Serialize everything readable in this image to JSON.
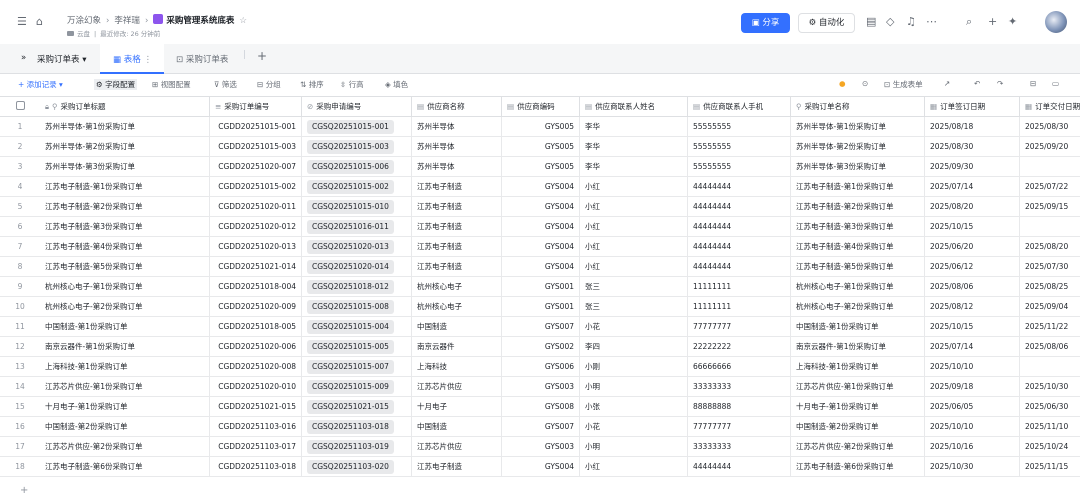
{
  "header": {
    "workspace": "万涂幻象",
    "owner": "李祥瑞",
    "title": "采购管理系统底表",
    "cloud_label": "云盘",
    "modified": "最近修改: 26 分钟前",
    "share_label": "分享",
    "automation_label": "自动化"
  },
  "tabs": {
    "collapse_icon": "»",
    "table_name": "采购订单表",
    "active_view": "表格",
    "form_view": "采购订单表",
    "add_icon": "+"
  },
  "toolbar": {
    "add_record": "添加记录",
    "field_config": "字段配置",
    "view_config": "视图配置",
    "filter": "筛选",
    "group": "分组",
    "sort": "排序",
    "row_height": "行高",
    "fill_color": "填色",
    "generate_form": "生成表单"
  },
  "columns": [
    {
      "label": "采购订单标题",
      "icon": "⚲"
    },
    {
      "label": "采购订单编号",
      "icon": "≡"
    },
    {
      "label": "采购申请编号",
      "icon": "⊘"
    },
    {
      "label": "供应商名称",
      "icon": "▤"
    },
    {
      "label": "供应商编码",
      "icon": "▤"
    },
    {
      "label": "供应商联系人姓名",
      "icon": "▤"
    },
    {
      "label": "供应商联系人手机",
      "icon": "▤"
    },
    {
      "label": "采购订单名称",
      "icon": "⚲"
    },
    {
      "label": "订单签订日期",
      "icon": "▦"
    },
    {
      "label": "订单交付日期",
      "icon": "▦"
    }
  ],
  "rows": [
    {
      "n": "1",
      "title": "苏州半导体-第1份采购订单",
      "po": "CGDD20251015-001",
      "req": "CGSQ20251015-001",
      "sup": "苏州半导体",
      "code": "GYS005",
      "contact": "李华",
      "phone": "55555555",
      "name": "苏州半导体-第1份采购订单",
      "sign": "2025/08/18",
      "deliver": "2025/08/30"
    },
    {
      "n": "2",
      "title": "苏州半导体-第2份采购订单",
      "po": "CGDD20251015-003",
      "req": "CGSQ20251015-003",
      "sup": "苏州半导体",
      "code": "GYS005",
      "contact": "李华",
      "phone": "55555555",
      "name": "苏州半导体-第2份采购订单",
      "sign": "2025/08/30",
      "deliver": "2025/09/20"
    },
    {
      "n": "3",
      "title": "苏州半导体-第3份采购订单",
      "po": "CGDD20251020-007",
      "req": "CGSQ20251015-006",
      "sup": "苏州半导体",
      "code": "GYS005",
      "contact": "李华",
      "phone": "55555555",
      "name": "苏州半导体-第3份采购订单",
      "sign": "2025/09/30",
      "deliver": ""
    },
    {
      "n": "4",
      "title": "江苏电子制造-第1份采购订单",
      "po": "CGDD20251015-002",
      "req": "CGSQ20251015-002",
      "sup": "江苏电子制造",
      "code": "GYS004",
      "contact": "小红",
      "phone": "44444444",
      "name": "江苏电子制造-第1份采购订单",
      "sign": "2025/07/14",
      "deliver": "2025/07/22"
    },
    {
      "n": "5",
      "title": "江苏电子制造-第2份采购订单",
      "po": "CGDD20251020-011",
      "req": "CGSQ20251015-010",
      "sup": "江苏电子制造",
      "code": "GYS004",
      "contact": "小红",
      "phone": "44444444",
      "name": "江苏电子制造-第2份采购订单",
      "sign": "2025/08/20",
      "deliver": "2025/09/15"
    },
    {
      "n": "6",
      "title": "江苏电子制造-第3份采购订单",
      "po": "CGDD20251020-012",
      "req": "CGSQ20251016-011",
      "sup": "江苏电子制造",
      "code": "GYS004",
      "contact": "小红",
      "phone": "44444444",
      "name": "江苏电子制造-第3份采购订单",
      "sign": "2025/10/15",
      "deliver": ""
    },
    {
      "n": "7",
      "title": "江苏电子制造-第4份采购订单",
      "po": "CGDD20251020-013",
      "req": "CGSQ20251020-013",
      "sup": "江苏电子制造",
      "code": "GYS004",
      "contact": "小红",
      "phone": "44444444",
      "name": "江苏电子制造-第4份采购订单",
      "sign": "2025/06/20",
      "deliver": "2025/08/20"
    },
    {
      "n": "8",
      "title": "江苏电子制造-第5份采购订单",
      "po": "CGDD20251021-014",
      "req": "CGSQ20251020-014",
      "sup": "江苏电子制造",
      "code": "GYS004",
      "contact": "小红",
      "phone": "44444444",
      "name": "江苏电子制造-第5份采购订单",
      "sign": "2025/06/12",
      "deliver": "2025/07/30"
    },
    {
      "n": "9",
      "title": "杭州核心电子-第1份采购订单",
      "po": "CGDD20251018-004",
      "req": "CGSQ20251018-012",
      "sup": "杭州核心电子",
      "code": "GYS001",
      "contact": "张三",
      "phone": "11111111",
      "name": "杭州核心电子-第1份采购订单",
      "sign": "2025/08/06",
      "deliver": "2025/08/25"
    },
    {
      "n": "10",
      "title": "杭州核心电子-第2份采购订单",
      "po": "CGDD20251020-009",
      "req": "CGSQ20251015-008",
      "sup": "杭州核心电子",
      "code": "GYS001",
      "contact": "张三",
      "phone": "11111111",
      "name": "杭州核心电子-第2份采购订单",
      "sign": "2025/08/12",
      "deliver": "2025/09/04"
    },
    {
      "n": "11",
      "title": "中国制造-第1份采购订单",
      "po": "CGDD20251018-005",
      "req": "CGSQ20251015-004",
      "sup": "中国制造",
      "code": "GYS007",
      "contact": "小花",
      "phone": "77777777",
      "name": "中国制造-第1份采购订单",
      "sign": "2025/10/15",
      "deliver": "2025/11/22"
    },
    {
      "n": "12",
      "title": "南京云器件-第1份采购订单",
      "po": "CGDD20251020-006",
      "req": "CGSQ20251015-005",
      "sup": "南京云器件",
      "code": "GYS002",
      "contact": "李四",
      "phone": "22222222",
      "name": "南京云器件-第1份采购订单",
      "sign": "2025/07/14",
      "deliver": "2025/08/06"
    },
    {
      "n": "13",
      "title": "上海科技-第1份采购订单",
      "po": "CGDD20251020-008",
      "req": "CGSQ20251015-007",
      "sup": "上海科技",
      "code": "GYS006",
      "contact": "小刚",
      "phone": "66666666",
      "name": "上海科技-第1份采购订单",
      "sign": "2025/10/10",
      "deliver": ""
    },
    {
      "n": "14",
      "title": "江苏芯片供应-第1份采购订单",
      "po": "CGDD20251020-010",
      "req": "CGSQ20251015-009",
      "sup": "江苏芯片供应",
      "code": "GYS003",
      "contact": "小明",
      "phone": "33333333",
      "name": "江苏芯片供应-第1份采购订单",
      "sign": "2025/09/18",
      "deliver": "2025/10/30"
    },
    {
      "n": "15",
      "title": "十月电子-第1份采购订单",
      "po": "CGDD20251021-015",
      "req": "CGSQ20251021-015",
      "sup": "十月电子",
      "code": "GYS008",
      "contact": "小张",
      "phone": "88888888",
      "name": "十月电子-第1份采购订单",
      "sign": "2025/06/05",
      "deliver": "2025/06/30"
    },
    {
      "n": "16",
      "title": "中国制造-第2份采购订单",
      "po": "CGDD20251103-016",
      "req": "CGSQ20251103-018",
      "sup": "中国制造",
      "code": "GYS007",
      "contact": "小花",
      "phone": "77777777",
      "name": "中国制造-第2份采购订单",
      "sign": "2025/10/10",
      "deliver": "2025/11/10"
    },
    {
      "n": "17",
      "title": "江苏芯片供应-第2份采购订单",
      "po": "CGDD20251103-017",
      "req": "CGSQ20251103-019",
      "sup": "江苏芯片供应",
      "code": "GYS003",
      "contact": "小明",
      "phone": "33333333",
      "name": "江苏芯片供应-第2份采购订单",
      "sign": "2025/10/16",
      "deliver": "2025/10/24"
    },
    {
      "n": "18",
      "title": "江苏电子制造-第6份采购订单",
      "po": "CGDD20251103-018",
      "req": "CGSQ20251103-020",
      "sup": "江苏电子制造",
      "code": "GYS004",
      "contact": "小红",
      "phone": "44444444",
      "name": "江苏电子制造-第6份采购订单",
      "sign": "2025/10/30",
      "deliver": "2025/11/15"
    }
  ],
  "add_row_icon": "+"
}
